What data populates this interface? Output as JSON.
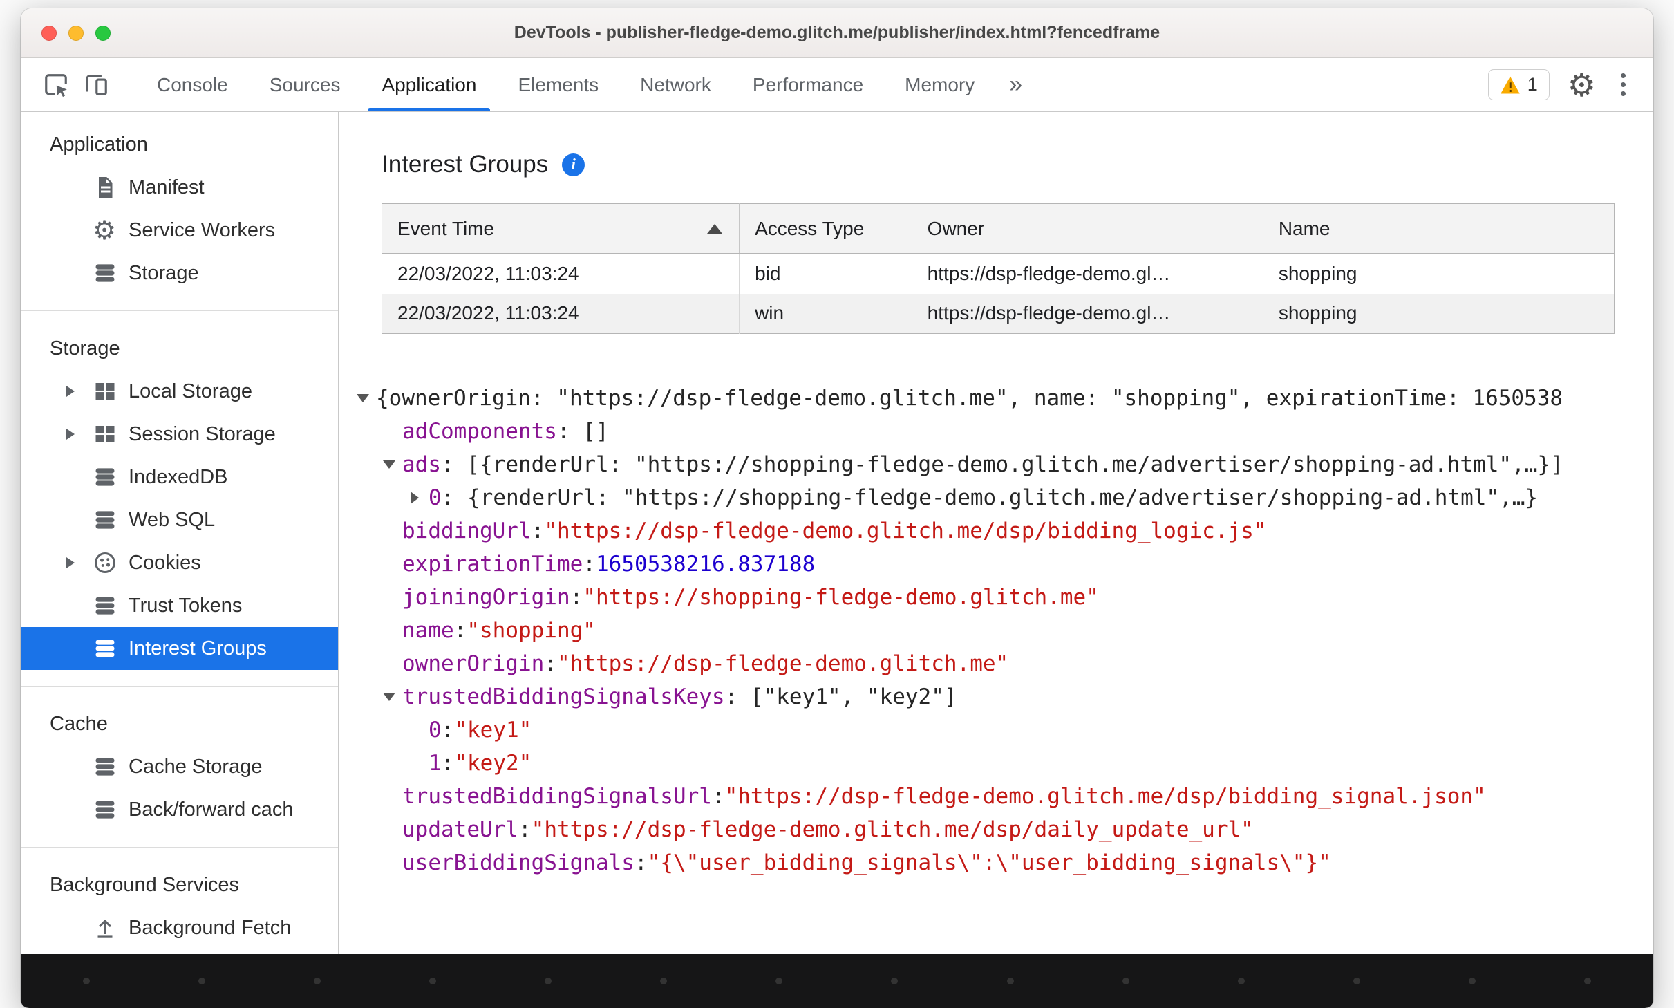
{
  "colors": {
    "accent": "#1a73e8",
    "selected_bg": "#1a73e8",
    "tree_key": "#881391",
    "tree_string": "#c41a16",
    "tree_number": "#1c00cf",
    "warning": "#f9ab00"
  },
  "window": {
    "title": "DevTools - publisher-fledge-demo.glitch.me/publisher/index.html?fencedframe"
  },
  "toolbar": {
    "tabs": [
      {
        "label": "Console",
        "active": false
      },
      {
        "label": "Sources",
        "active": false
      },
      {
        "label": "Application",
        "active": true
      },
      {
        "label": "Elements",
        "active": false
      },
      {
        "label": "Network",
        "active": false
      },
      {
        "label": "Performance",
        "active": false
      },
      {
        "label": "Memory",
        "active": false
      }
    ],
    "more_tabs_label": "»",
    "warning_count": "1"
  },
  "sidebar": {
    "sections": [
      {
        "header": "Application",
        "items": [
          {
            "label": "Manifest",
            "icon": "manifest-icon",
            "expandable": false,
            "selected": false
          },
          {
            "label": "Service Workers",
            "icon": "gear-icon",
            "expandable": false,
            "selected": false
          },
          {
            "label": "Storage",
            "icon": "database-icon",
            "expandable": false,
            "selected": false
          }
        ]
      },
      {
        "header": "Storage",
        "items": [
          {
            "label": "Local Storage",
            "icon": "table-icon",
            "expandable": true,
            "selected": false
          },
          {
            "label": "Session Storage",
            "icon": "table-icon",
            "expandable": true,
            "selected": false
          },
          {
            "label": "IndexedDB",
            "icon": "database-icon",
            "expandable": false,
            "selected": false
          },
          {
            "label": "Web SQL",
            "icon": "database-icon",
            "expandable": false,
            "selected": false
          },
          {
            "label": "Cookies",
            "icon": "cookie-icon",
            "expandable": true,
            "selected": false
          },
          {
            "label": "Trust Tokens",
            "icon": "database-icon",
            "expandable": false,
            "selected": false
          },
          {
            "label": "Interest Groups",
            "icon": "database-icon",
            "expandable": false,
            "selected": true
          }
        ]
      },
      {
        "header": "Cache",
        "items": [
          {
            "label": "Cache Storage",
            "icon": "database-icon",
            "expandable": false,
            "selected": false
          },
          {
            "label": "Back/forward cach",
            "icon": "database-icon",
            "expandable": false,
            "selected": false
          }
        ]
      },
      {
        "header": "Background Services",
        "items": [
          {
            "label": "Background Fetch",
            "icon": "fetch-icon",
            "expandable": false,
            "selected": false
          }
        ]
      }
    ]
  },
  "main": {
    "title": "Interest Groups",
    "table": {
      "columns": [
        "Event Time",
        "Access Type",
        "Owner",
        "Name"
      ],
      "sorted_by": "Event Time",
      "sort_dir": "asc",
      "rows": [
        [
          "22/03/2022, 11:03:24",
          "bid",
          "https://dsp-fledge-demo.gl…",
          "shopping"
        ],
        [
          "22/03/2022, 11:03:24",
          "win",
          "https://dsp-fledge-demo.gl…",
          "shopping"
        ]
      ]
    },
    "tree": {
      "lines": [
        {
          "indent": 0,
          "arrow": "down",
          "tokens": [
            [
              "plain",
              "{ownerOrigin: \"https://dsp-fledge-demo.glitch.me\", name: \"shopping\", expirationTime: 1650538"
            ]
          ]
        },
        {
          "indent": 1,
          "arrow": null,
          "tokens": [
            [
              "key",
              "adComponents"
            ],
            [
              "plain",
              ": []"
            ]
          ]
        },
        {
          "indent": 1,
          "arrow": "down",
          "tokens": [
            [
              "key",
              "ads"
            ],
            [
              "plain",
              ": [{renderUrl: \"https://shopping-fledge-demo.glitch.me/advertiser/shopping-ad.html\",…}]"
            ]
          ]
        },
        {
          "indent": 2,
          "arrow": "right",
          "tokens": [
            [
              "key",
              "0"
            ],
            [
              "plain",
              ": {renderUrl: \"https://shopping-fledge-demo.glitch.me/advertiser/shopping-ad.html\",…}"
            ]
          ]
        },
        {
          "indent": 1,
          "arrow": null,
          "tokens": [
            [
              "key",
              "biddingUrl"
            ],
            [
              "plain",
              ": "
            ],
            [
              "str",
              "\"https://dsp-fledge-demo.glitch.me/dsp/bidding_logic.js\""
            ]
          ]
        },
        {
          "indent": 1,
          "arrow": null,
          "tokens": [
            [
              "key",
              "expirationTime"
            ],
            [
              "plain",
              ": "
            ],
            [
              "num",
              "1650538216.837188"
            ]
          ]
        },
        {
          "indent": 1,
          "arrow": null,
          "tokens": [
            [
              "key",
              "joiningOrigin"
            ],
            [
              "plain",
              ": "
            ],
            [
              "str",
              "\"https://shopping-fledge-demo.glitch.me\""
            ]
          ]
        },
        {
          "indent": 1,
          "arrow": null,
          "tokens": [
            [
              "key",
              "name"
            ],
            [
              "plain",
              ": "
            ],
            [
              "str",
              "\"shopping\""
            ]
          ]
        },
        {
          "indent": 1,
          "arrow": null,
          "tokens": [
            [
              "key",
              "ownerOrigin"
            ],
            [
              "plain",
              ": "
            ],
            [
              "str",
              "\"https://dsp-fledge-demo.glitch.me\""
            ]
          ]
        },
        {
          "indent": 1,
          "arrow": "down",
          "tokens": [
            [
              "key",
              "trustedBiddingSignalsKeys"
            ],
            [
              "plain",
              ": [\"key1\", \"key2\"]"
            ]
          ]
        },
        {
          "indent": 2,
          "arrow": null,
          "tokens": [
            [
              "key",
              "0"
            ],
            [
              "plain",
              ": "
            ],
            [
              "str",
              "\"key1\""
            ]
          ]
        },
        {
          "indent": 2,
          "arrow": null,
          "tokens": [
            [
              "key",
              "1"
            ],
            [
              "plain",
              ": "
            ],
            [
              "str",
              "\"key2\""
            ]
          ]
        },
        {
          "indent": 1,
          "arrow": null,
          "tokens": [
            [
              "key",
              "trustedBiddingSignalsUrl"
            ],
            [
              "plain",
              ": "
            ],
            [
              "str",
              "\"https://dsp-fledge-demo.glitch.me/dsp/bidding_signal.json\""
            ]
          ]
        },
        {
          "indent": 1,
          "arrow": null,
          "tokens": [
            [
              "key",
              "updateUrl"
            ],
            [
              "plain",
              ": "
            ],
            [
              "str",
              "\"https://dsp-fledge-demo.glitch.me/dsp/daily_update_url\""
            ]
          ]
        },
        {
          "indent": 1,
          "arrow": null,
          "tokens": [
            [
              "key",
              "userBiddingSignals"
            ],
            [
              "plain",
              ": "
            ],
            [
              "str",
              "\"{\\\"user_bidding_signals\\\":\\\"user_bidding_signals\\\"}\""
            ]
          ]
        }
      ]
    }
  }
}
